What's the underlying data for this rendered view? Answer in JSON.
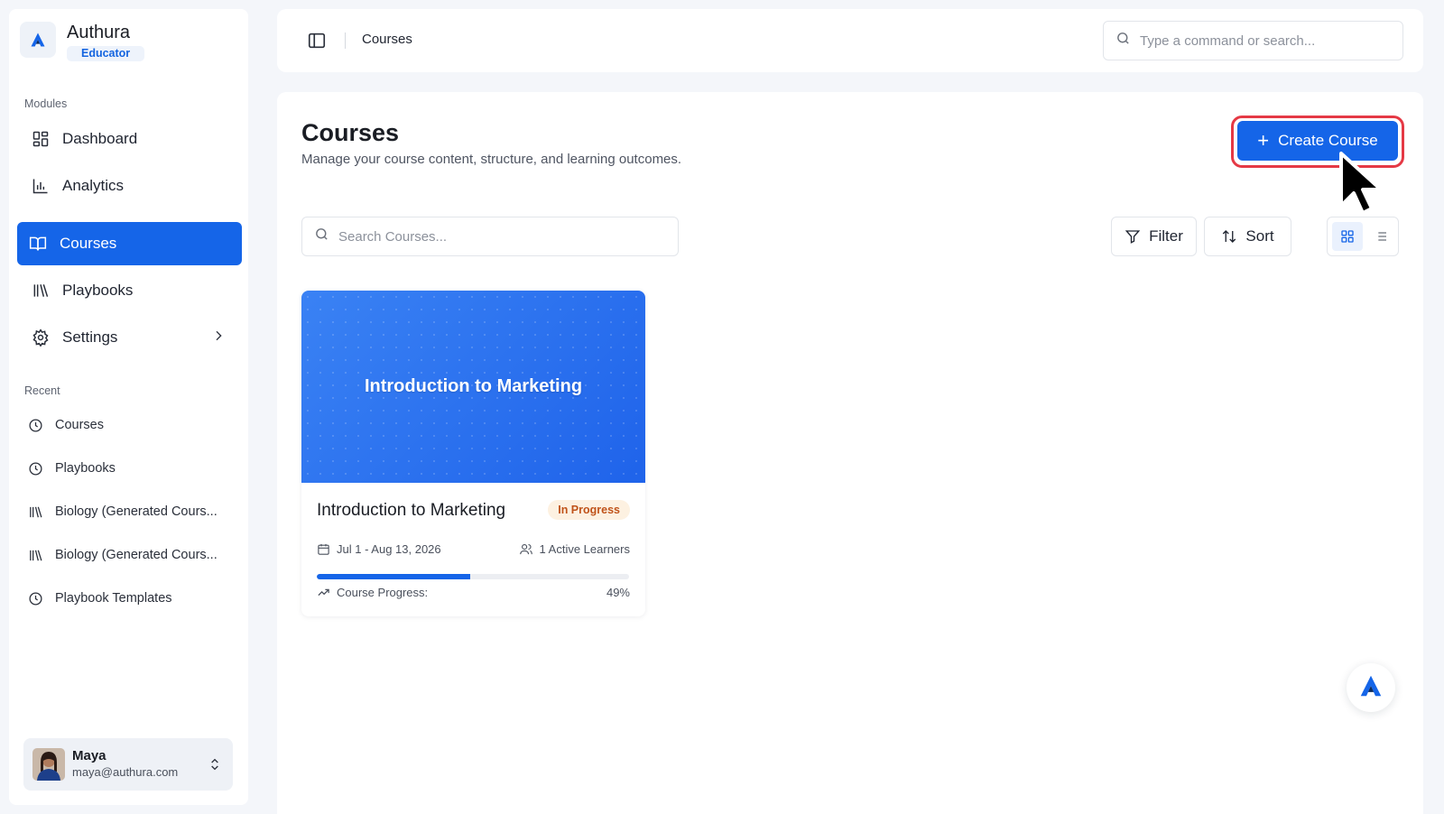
{
  "brand": {
    "name": "Authura",
    "role": "Educator"
  },
  "sidebar": {
    "modules_label": "Modules",
    "items": [
      {
        "label": "Dashboard",
        "icon": "dashboard-icon"
      },
      {
        "label": "Analytics",
        "icon": "bar-chart-icon"
      },
      {
        "label": "Courses",
        "icon": "book-open-icon",
        "active": true
      },
      {
        "label": "Playbooks",
        "icon": "library-icon"
      },
      {
        "label": "Settings",
        "icon": "gear-icon"
      }
    ],
    "recent_label": "Recent",
    "recent": [
      {
        "label": "Courses",
        "icon": "clock-icon"
      },
      {
        "label": "Playbooks",
        "icon": "clock-icon"
      },
      {
        "label": "Biology (Generated Cours...",
        "icon": "library-icon"
      },
      {
        "label": "Biology (Generated Cours...",
        "icon": "library-icon"
      },
      {
        "label": "Playbook Templates",
        "icon": "clock-icon"
      }
    ],
    "user": {
      "name": "Maya",
      "email": "maya@authura.com"
    }
  },
  "topbar": {
    "breadcrumb": "Courses",
    "search_placeholder": "Type a command or search..."
  },
  "main": {
    "title": "Courses",
    "subtitle": "Manage your course content, structure, and learning outcomes.",
    "create_label": "Create Course",
    "search_placeholder": "Search Courses...",
    "filter_label": "Filter",
    "sort_label": "Sort",
    "courses": [
      {
        "cover_title": "Introduction to Marketing",
        "title": "Introduction to Marketing",
        "status": "In Progress",
        "dates": "Jul 1 - Aug 13, 2026",
        "learners": "1 Active Learners",
        "progress_label": "Course Progress:",
        "progress_text": "49%",
        "progress_fraction": 0.49
      }
    ]
  },
  "colors": {
    "accent": "#1565e8",
    "highlight_ring": "#e53945",
    "badge_bg": "#fdf1e1",
    "badge_text": "#c0531a"
  }
}
